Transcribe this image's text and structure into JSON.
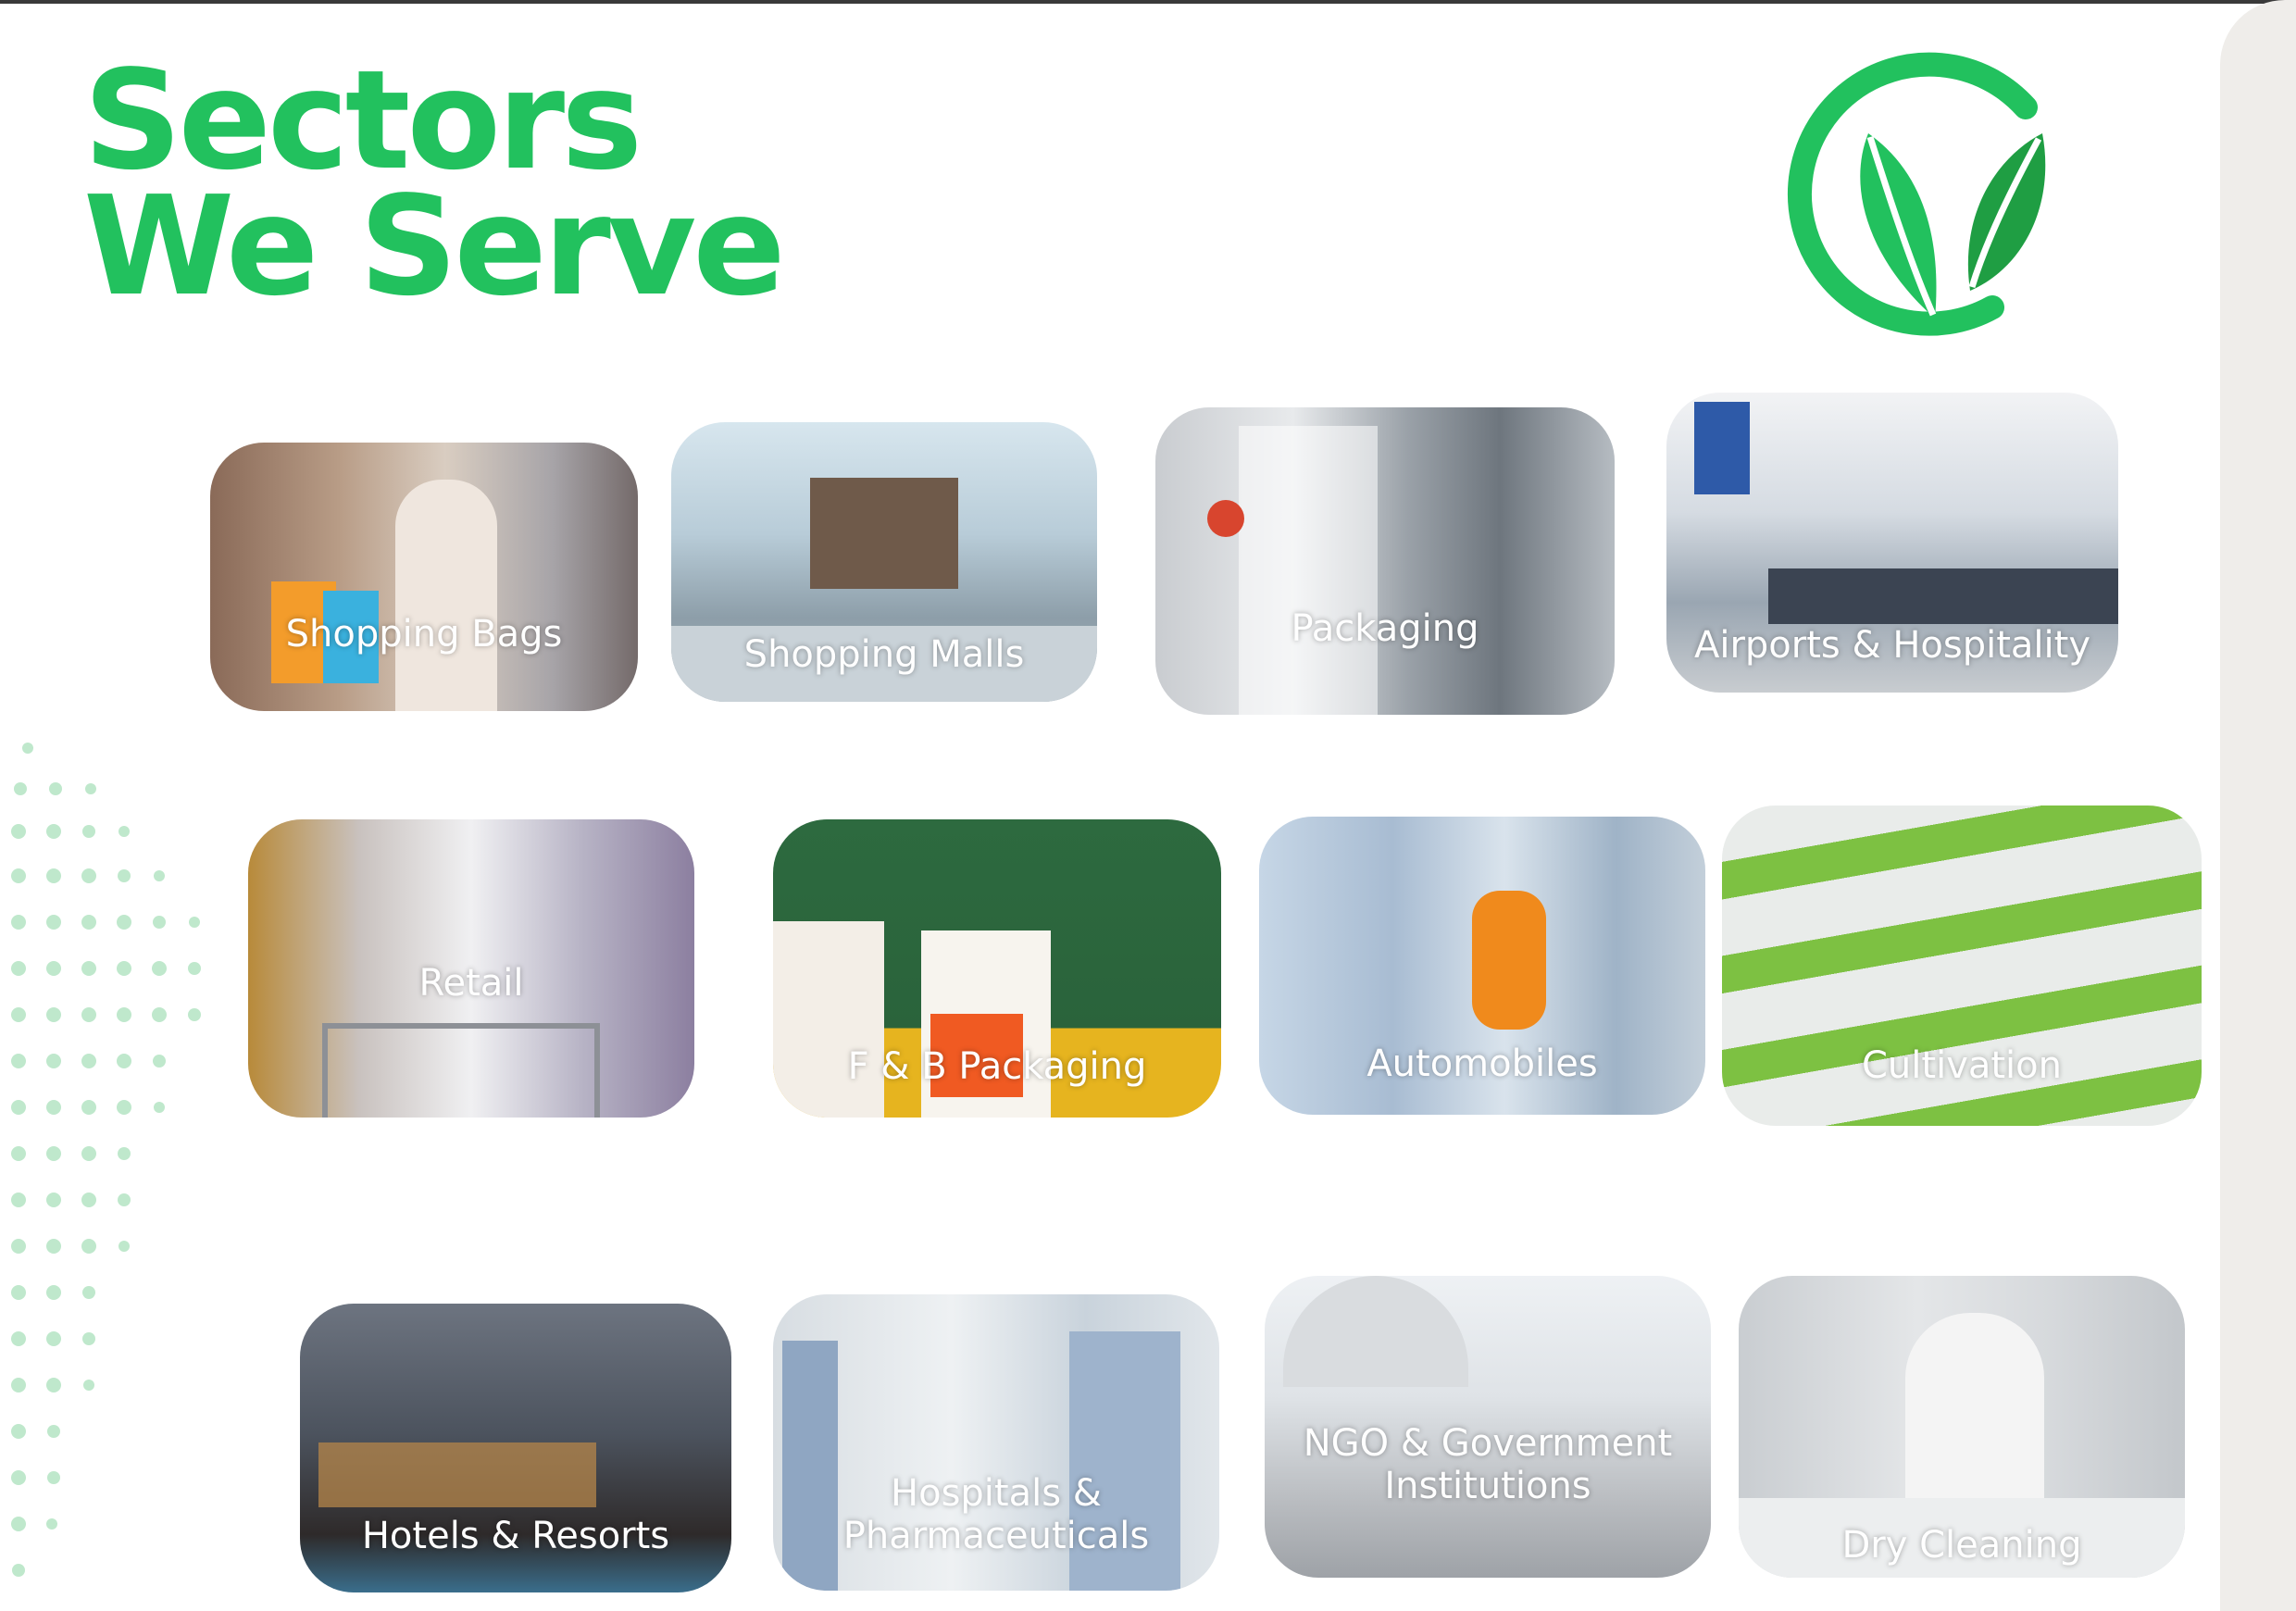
{
  "heading": {
    "line1": "Sectors",
    "line2": "We Serve"
  },
  "colors": {
    "brand_green": "#22c15e",
    "logo_green": "#1f9e43",
    "dot_green": "#bfe8cc",
    "panel": "#efedea"
  },
  "sectors": [
    {
      "label": "Shopping Bags"
    },
    {
      "label": "Shopping Malls"
    },
    {
      "label": "Packaging"
    },
    {
      "label": "Airports & Hospitality"
    },
    {
      "label": "Retail"
    },
    {
      "label": "F & B Packaging"
    },
    {
      "label": "Automobiles"
    },
    {
      "label": "Cultivation"
    },
    {
      "label": "Hotels & Resorts"
    },
    {
      "label": "Hospitals & Pharmaceuticals"
    },
    {
      "label": "NGO & Government Institutions"
    },
    {
      "label": "Dry Cleaning"
    }
  ]
}
